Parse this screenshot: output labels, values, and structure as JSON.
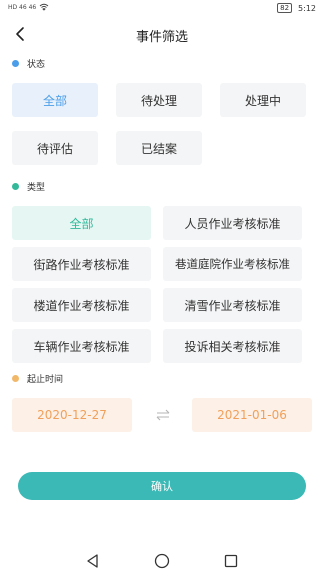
{
  "status_bar": {
    "left": "HD 46 46",
    "battery": "82",
    "time": "5:12"
  },
  "nav": {
    "title": "事件筛选"
  },
  "status_section": {
    "title": "状态",
    "dot_color": "#4a9de8",
    "chips": [
      "全部",
      "待处理",
      "处理中",
      "待评估",
      "已结案"
    ],
    "selected": "全部"
  },
  "type_section": {
    "title": "类型",
    "dot_color": "#33b89a",
    "chips": [
      "全部",
      "人员作业考核标准",
      "街路作业考核标准",
      "巷道庭院作业考核标准",
      "楼道作业考核标准",
      "清雪作业考核标准",
      "车辆作业考核标准",
      "投诉相关考核标准"
    ],
    "selected": "全部"
  },
  "time_section": {
    "title": "起止时间",
    "dot_color": "#f2b86a",
    "start_date": "2020-12-27",
    "end_date": "2021-01-06"
  },
  "confirm_button": {
    "label": "确认",
    "color": "#3bb9b6"
  },
  "icons": {
    "back": "back-arrow-icon",
    "swap": "swap-arrows-icon",
    "sys_back": "triangle-back-icon",
    "sys_home": "circle-home-icon",
    "sys_recent": "square-recent-icon"
  }
}
